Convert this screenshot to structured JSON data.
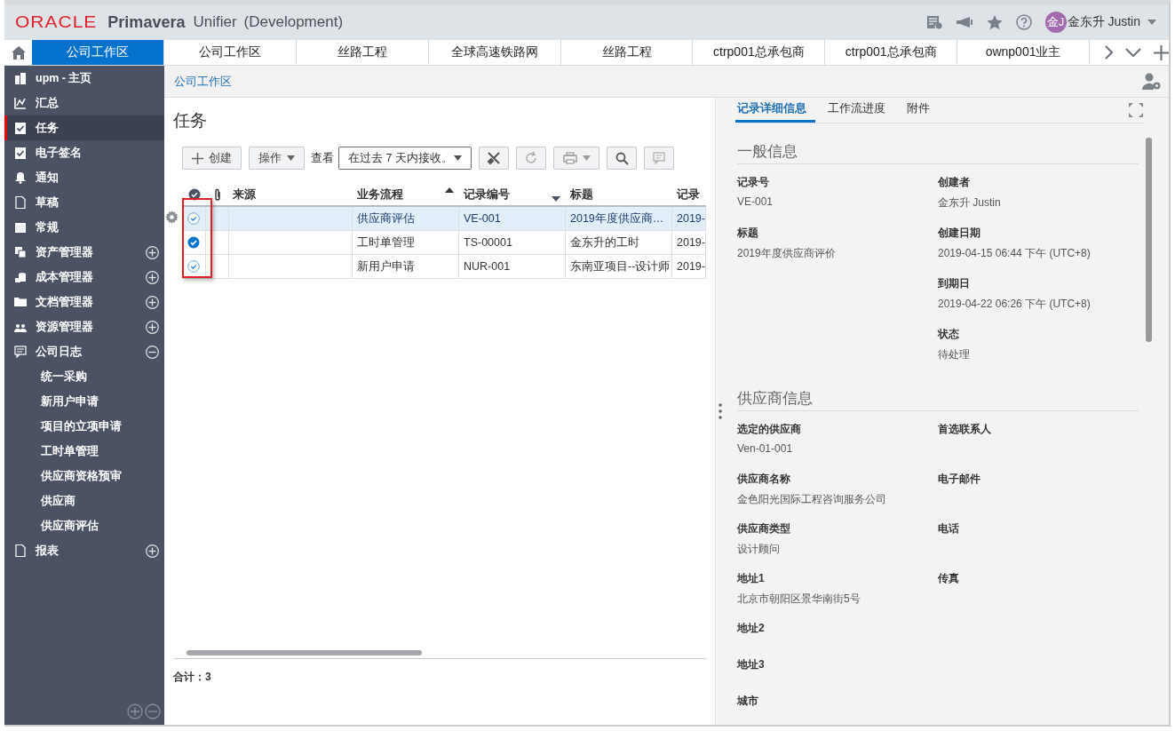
{
  "header": {
    "logo": "ORACLE",
    "product": "Primavera",
    "app": "Unifier",
    "environment": "(Development)",
    "avatar": "金J",
    "user": "金东升 Justin"
  },
  "tabs": [
    {
      "label": "公司工作区",
      "selected": true
    },
    {
      "label": "公司工作区",
      "selected": false
    },
    {
      "label": "丝路工程",
      "selected": false
    },
    {
      "label": "全球高速铁路网",
      "selected": false
    },
    {
      "label": "丝路工程",
      "selected": false
    },
    {
      "label": "ctrp001总承包商",
      "selected": false
    },
    {
      "label": "ctrp001总承包商",
      "selected": false
    },
    {
      "label": "ownp001业主",
      "selected": false
    }
  ],
  "sidebar": {
    "items": [
      {
        "label": "upm - 主页",
        "kind": "link",
        "selected": false
      },
      {
        "label": "汇总",
        "kind": "link",
        "selected": false
      },
      {
        "label": "任务",
        "kind": "link",
        "selected": true
      },
      {
        "label": "电子签名",
        "kind": "link",
        "selected": false
      },
      {
        "label": "通知",
        "kind": "link",
        "selected": false
      },
      {
        "label": "草稿",
        "kind": "link",
        "selected": false
      },
      {
        "label": "常规",
        "kind": "link",
        "selected": false
      },
      {
        "label": "资产管理器",
        "kind": "group",
        "selected": false,
        "expanded": false
      },
      {
        "label": "成本管理器",
        "kind": "group",
        "selected": false,
        "expanded": false
      },
      {
        "label": "文档管理器",
        "kind": "group",
        "selected": false,
        "expanded": false
      },
      {
        "label": "资源管理器",
        "kind": "group",
        "selected": false,
        "expanded": false
      },
      {
        "label": "公司日志",
        "kind": "group",
        "selected": false,
        "expanded": true,
        "children": [
          {
            "label": "统一采购",
            "selected": false
          },
          {
            "label": "新用户申请",
            "selected": false
          },
          {
            "label": "项目的立项申请",
            "selected": false
          },
          {
            "label": "工时单管理",
            "selected": false
          },
          {
            "label": "供应商资格预审",
            "selected": false
          },
          {
            "label": "供应商",
            "selected": false
          },
          {
            "label": "供应商评估",
            "selected": false
          }
        ]
      },
      {
        "label": "报表",
        "kind": "group",
        "selected": false,
        "expanded": false
      }
    ]
  },
  "breadcrumb": "公司工作区",
  "page_title": "任务",
  "toolbar": {
    "create": "创建",
    "actions": "操作",
    "view_label": "查看",
    "view_value": "在过去 7 天内接收。"
  },
  "table": {
    "columns": [
      {
        "label": "来源",
        "sort_up": false,
        "sort_down": false
      },
      {
        "label": "业务流程",
        "sort_up": true,
        "sort_down": false
      },
      {
        "label": "记录编号",
        "sort_up": false,
        "sort_down": true
      },
      {
        "label": "标题",
        "sort_up": false,
        "sort_down": false
      },
      {
        "label": "记录",
        "sort_up": false,
        "sort_down": false
      }
    ],
    "rows": [
      {
        "selected": true,
        "checked": false,
        "cells": [
          "",
          "供应商评估",
          "VE-001",
          "2019年度供应商…",
          "2019-"
        ]
      },
      {
        "selected": false,
        "checked": true,
        "cells": [
          "",
          "工时单管理",
          "TS-00001",
          "金东升的工时",
          "2019-"
        ]
      },
      {
        "selected": false,
        "checked": false,
        "cells": [
          "",
          "新用户申请",
          "NUR-001",
          "东南亚项目--设计师",
          "2019-"
        ]
      }
    ]
  },
  "total": "合计：3",
  "detail": {
    "tabs": [
      {
        "label": "记录详细信息",
        "selected": true
      },
      {
        "label": "工作流进度",
        "selected": false
      },
      {
        "label": "附件",
        "selected": false
      }
    ],
    "sections": [
      {
        "title": "一般信息",
        "left": [
          {
            "label": "记录号",
            "value": "VE-001"
          },
          {
            "label": "标题",
            "value": "2019年度供应商评价"
          }
        ],
        "right": [
          {
            "label": "创建者",
            "value": "金东升 Justin"
          },
          {
            "label": "创建日期",
            "value": "2019-04-15 06:44 下午 (UTC+8)"
          },
          {
            "label": "到期日",
            "value": "2019-04-22 06:26 下午 (UTC+8)"
          },
          {
            "label": "状态",
            "value": "待处理"
          }
        ]
      },
      {
        "title": "供应商信息",
        "rows": [
          [
            {
              "label": "选定的供应商",
              "value": "Ven-01-001"
            },
            {
              "label": "首选联系人"
            }
          ],
          [
            {
              "label": "供应商名称",
              "value": "金色阳光国际工程咨询服务公司"
            },
            {
              "label": "电子邮件"
            }
          ],
          [
            {
              "label": "供应商类型",
              "value": "设计顾问"
            },
            {
              "label": "电话"
            }
          ],
          [
            {
              "label": "地址1",
              "value": "北京市朝阳区景华南街5号"
            },
            {
              "label": "传真"
            }
          ],
          [
            {
              "label": "地址2"
            }
          ],
          [
            {
              "label": "地址3"
            }
          ],
          [
            {
              "label": "城市"
            }
          ]
        ]
      }
    ]
  }
}
